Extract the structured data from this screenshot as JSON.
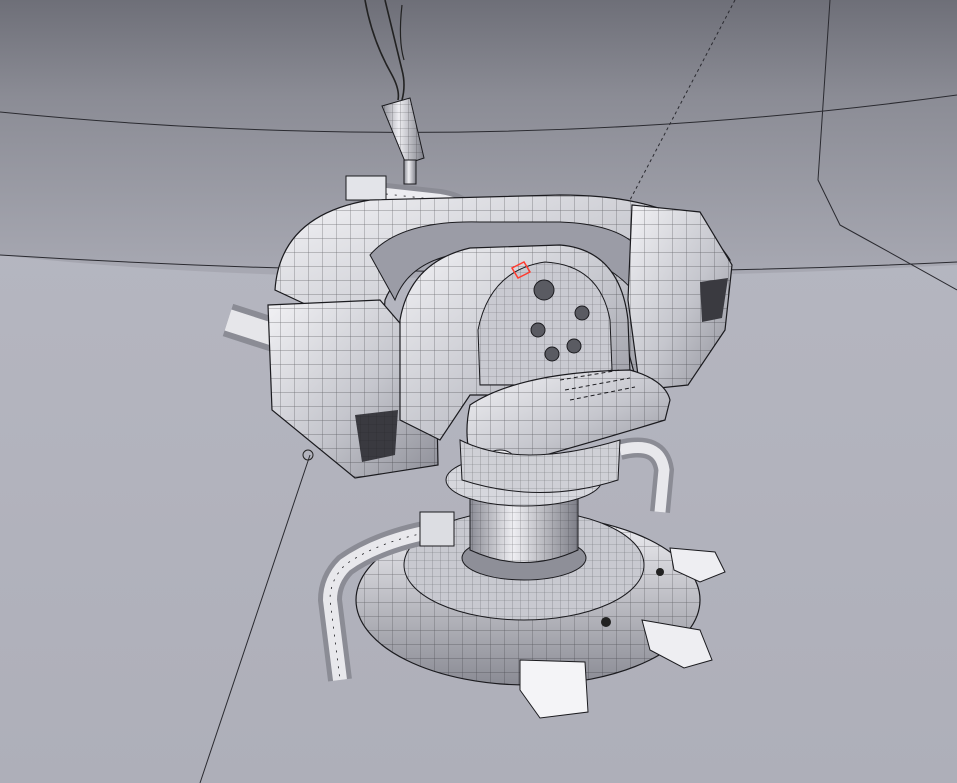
{
  "viewport": {
    "label": "",
    "shading": "solid-wireframe",
    "colors": {
      "background": "#b7b8c2",
      "dome": "#7d7e86",
      "model_light": "#e6e7ec",
      "model_mid": "#b9bac2",
      "model_dark": "#7f8089",
      "wire": "#1b1b1f",
      "selection": "#ff3b2f"
    }
  },
  "scene_objects": [
    {
      "id": "turret-chair",
      "kind": "mesh"
    },
    {
      "id": "hanging-cable",
      "kind": "mesh"
    },
    {
      "id": "pedestal-base",
      "kind": "mesh"
    },
    {
      "id": "room-dome",
      "kind": "mesh"
    }
  ],
  "icons": {
    "cursor": "3d-cursor-icon"
  }
}
